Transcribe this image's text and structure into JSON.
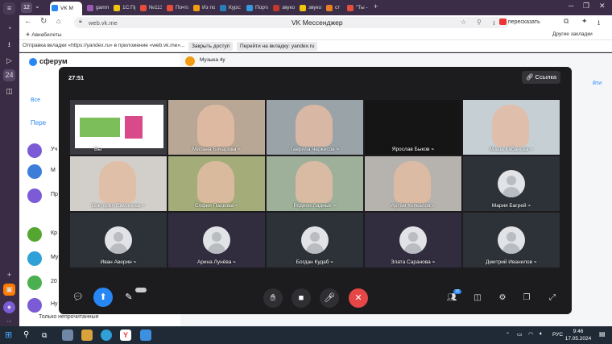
{
  "browser": {
    "tab_count": "12",
    "tabs": [
      {
        "label": "VK M",
        "color": "#2787f5",
        "active": true
      },
      {
        "label": "gamma",
        "color": "#9b59b6"
      },
      {
        "label": "1С:Пре",
        "color": "#f1c40f"
      },
      {
        "label": "№113",
        "color": "#e74c3c"
      },
      {
        "label": "Почта",
        "color": "#e74c3c"
      },
      {
        "label": "Из поч",
        "color": "#f39c12"
      },
      {
        "label": "Курс:Р",
        "color": "#2980b9"
      },
      {
        "label": "Портал",
        "color": "#3498db"
      },
      {
        "label": "звуко",
        "color": "#c0392b"
      },
      {
        "label": "звуко",
        "color": "#f1c40f"
      },
      {
        "label": "ст",
        "color": "#e67e22"
      },
      {
        "label": "\"Ты - Ч",
        "color": "#e74c3c"
      }
    ],
    "url": "web.vk.me",
    "page_title": "VK Мессенджер",
    "share_label": "пересказать",
    "bookmark": "Авиабилеты",
    "other_bookmarks": "Другие закладки",
    "infobar": {
      "message": "Отправка вкладки «https://yandex.ru» в приложение «web.vk.me»...",
      "close_access": "Закрыть доступ",
      "goto_tab": "Перейти на вкладку: yandex.ru"
    }
  },
  "vk": {
    "logo": "сферум",
    "header_chat": "Музыка 4у",
    "filter_all": "Все",
    "item_first": "Пере",
    "list_letters": [
      "Уч",
      "М",
      "Пр",
      "Кр",
      "Му",
      "20",
      "Ну"
    ],
    "right_link": "йти",
    "only_unread": "Только непрочитанные"
  },
  "call": {
    "timer": "27:51",
    "link_label": "Ссылка",
    "participants": [
      {
        "name": "Вы",
        "video": "screen"
      },
      {
        "name": "Милана Бочарова",
        "video": "#b8a795"
      },
      {
        "name": "Гаврила Черкесов",
        "video": "#9aa3a8"
      },
      {
        "name": "Ярослав Быков",
        "video": "#151515"
      },
      {
        "name": "Маша Кабанова",
        "video": "#c6cfd4"
      },
      {
        "name": "Виктория Симонова",
        "video": "#d2cfcb"
      },
      {
        "name": "София Пацкова",
        "video": "#a4ad7a"
      },
      {
        "name": "Родион Ладных",
        "video": "#9fb09a"
      },
      {
        "name": "Артём Кипкалов",
        "video": "#b6b2ad"
      },
      {
        "name": "Мария Багрей",
        "video": "avatar"
      },
      {
        "name": "Иван Аверин",
        "video": "avatar"
      },
      {
        "name": "Арина Лунёва",
        "video": "avatar"
      },
      {
        "name": "Богдан Кудаб",
        "video": "avatar"
      },
      {
        "name": "Злата Саранова",
        "video": "avatar"
      },
      {
        "name": "Дмитрий Иванилов",
        "video": "avatar"
      }
    ],
    "participant_count": "15",
    "end_color": "#e64646",
    "share_color": "#2787f5"
  },
  "taskbar": {
    "weather": "10°C",
    "lang": "РУС",
    "time": "9:46",
    "date": "17.05.2024"
  }
}
